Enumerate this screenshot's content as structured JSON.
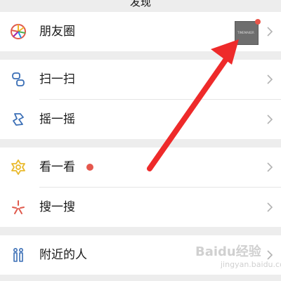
{
  "header": {
    "title": "发现"
  },
  "menu": {
    "moments": {
      "label": "朋友圈",
      "icon": "moments-icon",
      "thumbnail_text": "TIMEMAKER"
    },
    "scan": {
      "label": "扫一扫",
      "icon": "scan-icon"
    },
    "shake": {
      "label": "摇一摇",
      "icon": "shake-icon"
    },
    "top_stories": {
      "label": "看一看",
      "icon": "top-stories-icon"
    },
    "search": {
      "label": "搜一搜",
      "icon": "search-icon"
    },
    "nearby": {
      "label": "附近的人",
      "icon": "people-nearby-icon"
    }
  },
  "colors": {
    "background": "#ededed",
    "row": "#ffffff",
    "badge": "#e5574d",
    "arrow": "#ee2a2a",
    "icon_blue": "#3b6fb6",
    "icon_yellow": "#e9b92c"
  },
  "watermark": {
    "brand": "Baidu经验",
    "url": "jingyan.baidu.com"
  }
}
